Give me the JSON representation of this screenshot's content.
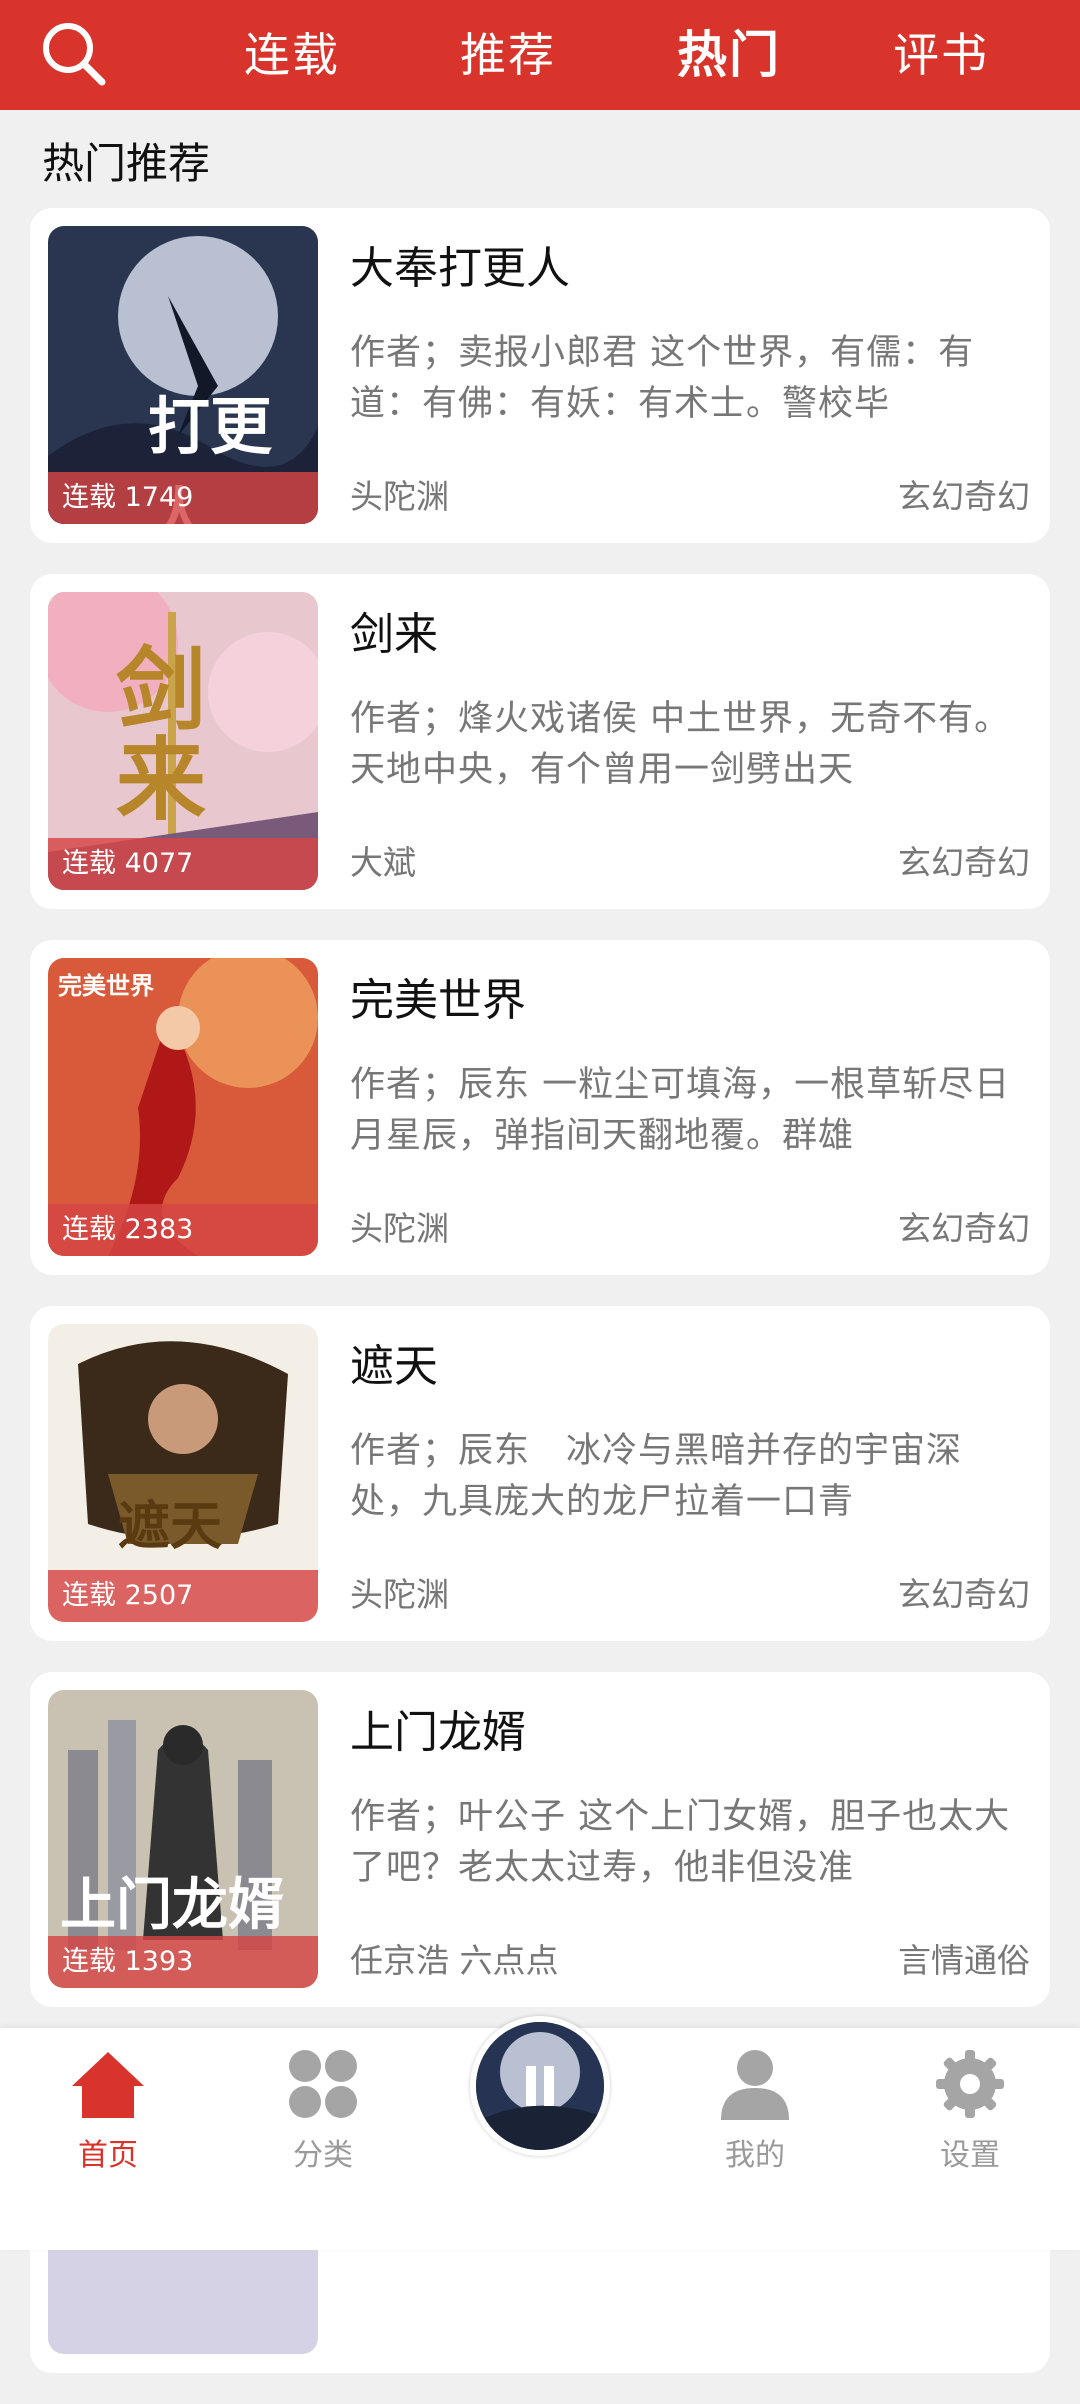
{
  "header": {
    "tabs": [
      {
        "label": "连载"
      },
      {
        "label": "推荐"
      },
      {
        "label": "热门"
      },
      {
        "label": "评书"
      }
    ]
  },
  "section": {
    "title": "热门推荐"
  },
  "books": [
    {
      "title": "大奉打更人",
      "desc": "作者；卖报小郎君 这个世界，有儒：有道：有佛：有妖：有术士。警校毕",
      "source": "头陀渊",
      "genre": "玄幻奇幻",
      "badge": "连载 1749",
      "cover_text": "打更人"
    },
    {
      "title": "剑来",
      "desc": "作者；烽火戏诸侯 中土世界，无奇不有。天地中央，有个曾用一剑劈出天",
      "source": "大斌",
      "genre": "玄幻奇幻",
      "badge": "连载 4077",
      "cover_text": "剑来"
    },
    {
      "title": "完美世界",
      "desc": "作者；辰东 一粒尘可填海，一根草斩尽日月星辰，弹指间天翻地覆。群雄",
      "source": "头陀渊",
      "genre": "玄幻奇幻",
      "badge": "连载 2383",
      "cover_text": "完美世界"
    },
    {
      "title": "遮天",
      "desc": "作者；辰东　冰冷与黑暗并存的宇宙深处，九具庞大的龙尸拉着一口青",
      "source": "头陀渊",
      "genre": "玄幻奇幻",
      "badge": "连载 2507",
      "cover_text": "遮天"
    },
    {
      "title": "上门龙婿",
      "desc": "作者；叶公子 这个上门女婿，胆子也太大了吧？老太太过寿，他非但没准",
      "source": "任京浩 六点点",
      "genre": "言情通俗",
      "badge": "连载 1393",
      "cover_text": "上门龙婿"
    }
  ],
  "nav": [
    {
      "label": "首页",
      "icon": "home-icon"
    },
    {
      "label": "分类",
      "icon": "category-icon"
    },
    {
      "label": "我的",
      "icon": "profile-icon"
    },
    {
      "label": "设置",
      "icon": "gear-icon"
    }
  ],
  "colors": {
    "brand": "#d9342b",
    "nav_active": "#d9342b",
    "nav_inactive": "#9a9a9a"
  }
}
